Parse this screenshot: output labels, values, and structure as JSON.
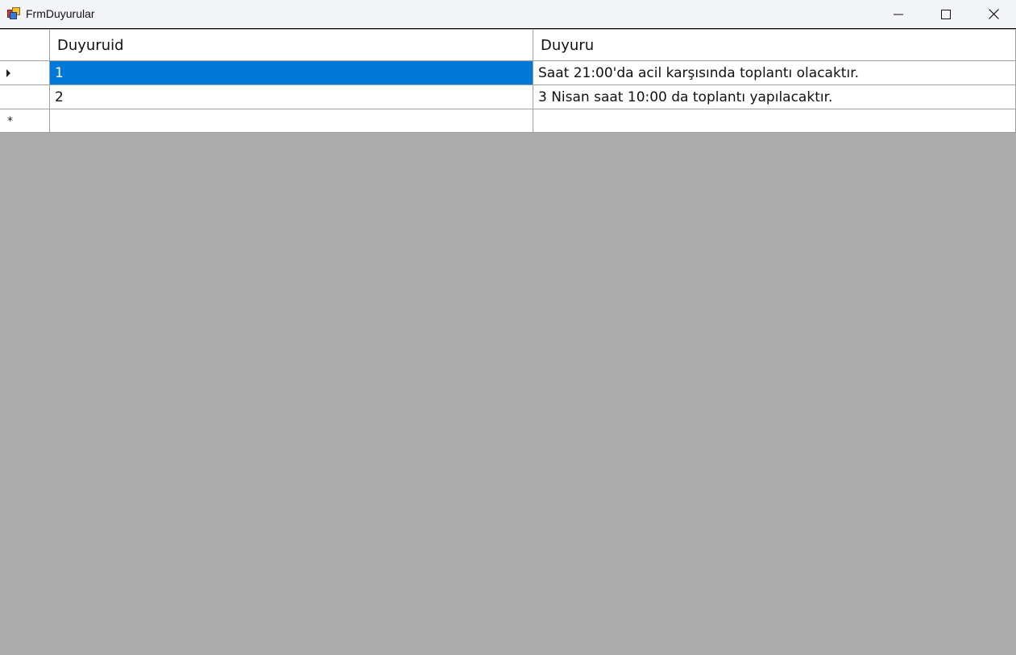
{
  "window": {
    "title": "FrmDuyurular",
    "controls": {
      "minimize_icon": "minimize-icon",
      "maximize_icon": "maximize-icon",
      "close_icon": "close-icon"
    }
  },
  "grid": {
    "columns": [
      "Duyuruid",
      "Duyuru"
    ],
    "rows": [
      {
        "id": "1",
        "text": "Saat 21:00'da acil karşısında toplantı olacaktır.",
        "selected": true,
        "current": true
      },
      {
        "id": "2",
        "text": "3 Nisan saat 10:00 da toplantı yapılacaktır.",
        "selected": false,
        "current": false
      },
      {
        "id": "",
        "text": "",
        "new_row": true
      }
    ],
    "new_row_marker": "*",
    "colors": {
      "selection": "#0078d7",
      "grid_line": "#a0a0a0",
      "background_empty": "#ababab"
    }
  }
}
